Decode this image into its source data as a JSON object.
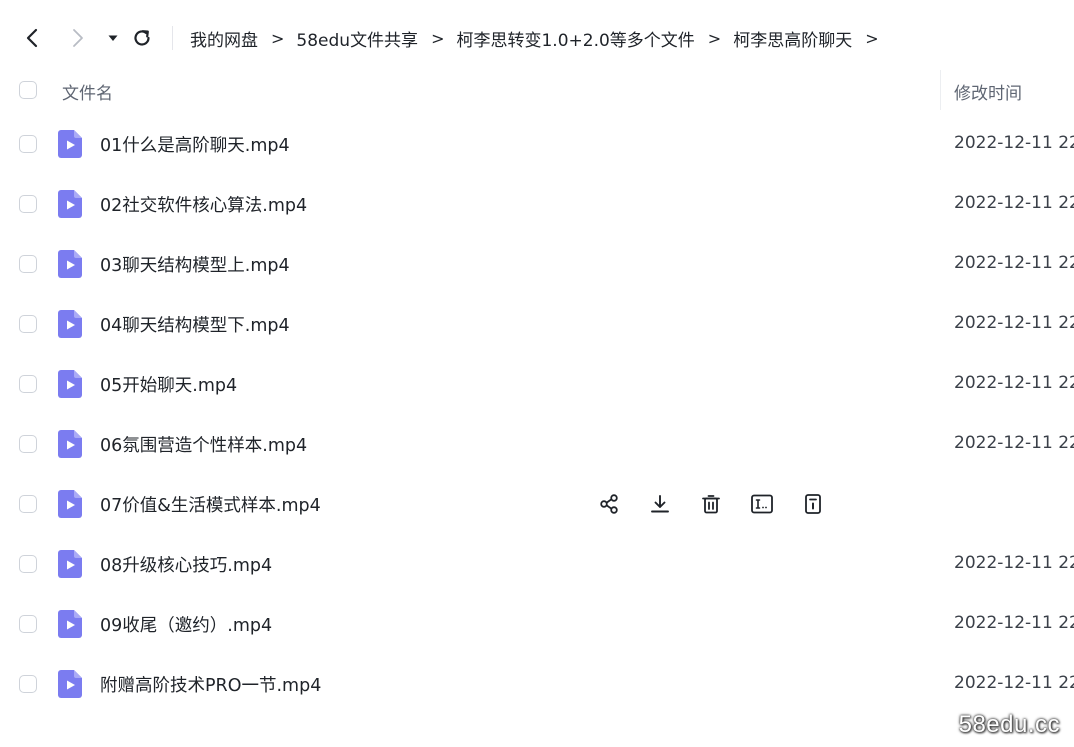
{
  "nav": {
    "back_icon": "chevron-left-icon",
    "forward_icon": "chevron-right-icon",
    "dropdown_icon": "caret-down-icon",
    "refresh_icon": "refresh-icon"
  },
  "breadcrumbs": [
    {
      "label": "我的网盘"
    },
    {
      "label": "58edu文件共享"
    },
    {
      "label": "柯李思转变1.0+2.0等多个文件"
    },
    {
      "label": "柯李思高阶聊天"
    }
  ],
  "breadcrumb_separator": ">",
  "table": {
    "col_name": "文件名",
    "col_time": "修改时间"
  },
  "files": [
    {
      "name": "01什么是高阶聊天.mp4",
      "time": "2022-12-11 22"
    },
    {
      "name": "02社交软件核心算法.mp4",
      "time": "2022-12-11 22"
    },
    {
      "name": "03聊天结构模型上.mp4",
      "time": "2022-12-11 22"
    },
    {
      "name": "04聊天结构模型下.mp4",
      "time": "2022-12-11 22"
    },
    {
      "name": "05开始聊天.mp4",
      "time": "2022-12-11 22"
    },
    {
      "name": "06氛围营造个性样本.mp4",
      "time": "2022-12-11 22"
    },
    {
      "name": "07价值&生活模式样本.mp4",
      "time": ""
    },
    {
      "name": "08升级核心技巧.mp4",
      "time": "2022-12-11 22"
    },
    {
      "name": "09收尾（邀约）.mp4",
      "time": "2022-12-11 22"
    },
    {
      "name": "附赠高阶技术PRO一节.mp4",
      "time": "2022-12-11 22"
    }
  ],
  "row_actions": [
    "share-icon",
    "download-icon",
    "delete-icon",
    "rename-icon",
    "details-icon"
  ],
  "colors": {
    "video_icon": "#7b7cf0",
    "text": "#1f2329",
    "muted": "#5f6673"
  },
  "watermark": "58edu.cc"
}
